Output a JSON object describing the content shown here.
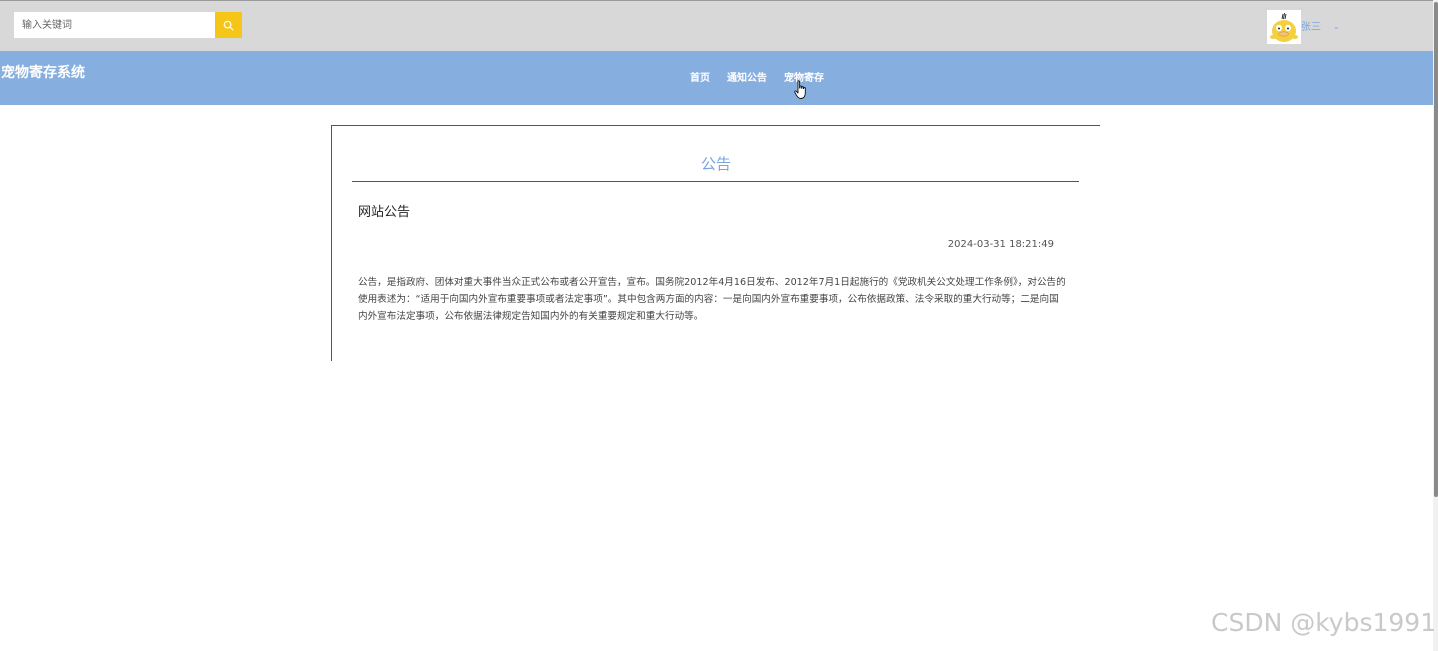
{
  "search": {
    "placeholder": "输入关键词"
  },
  "user": {
    "name": "张三",
    "caret": "⌄"
  },
  "navbar": {
    "brand": "宠物寄存系统",
    "items": [
      {
        "label": "首页"
      },
      {
        "label": "通知公告"
      },
      {
        "label": "宠物寄存"
      }
    ]
  },
  "card": {
    "title": "公告",
    "notice_title": "网站公告",
    "date": "2024-03-31 18:21:49",
    "body": "公告，是指政府、团体对重大事件当众正式公布或者公开宣告，宣布。国务院2012年4月16日发布、2012年7月1日起施行的《党政机关公文处理工作条例》，对公告的使用表述为：“适用于向国内外宣布重要事项或者法定事项”。其中包含两方面的内容：一是向国内外宣布重要事项，公布依据政策、法令采取的重大行动等；二是向国内外宣布法定事项，公布依据法律规定告知国内外的有关重要规定和重大行动等。"
  },
  "watermark": "CSDN @kybs1991",
  "colors": {
    "topbar": "#d8d8d8",
    "navbar": "#86aedf",
    "search_button": "#f5c518",
    "accent_text": "#7aa5de"
  }
}
